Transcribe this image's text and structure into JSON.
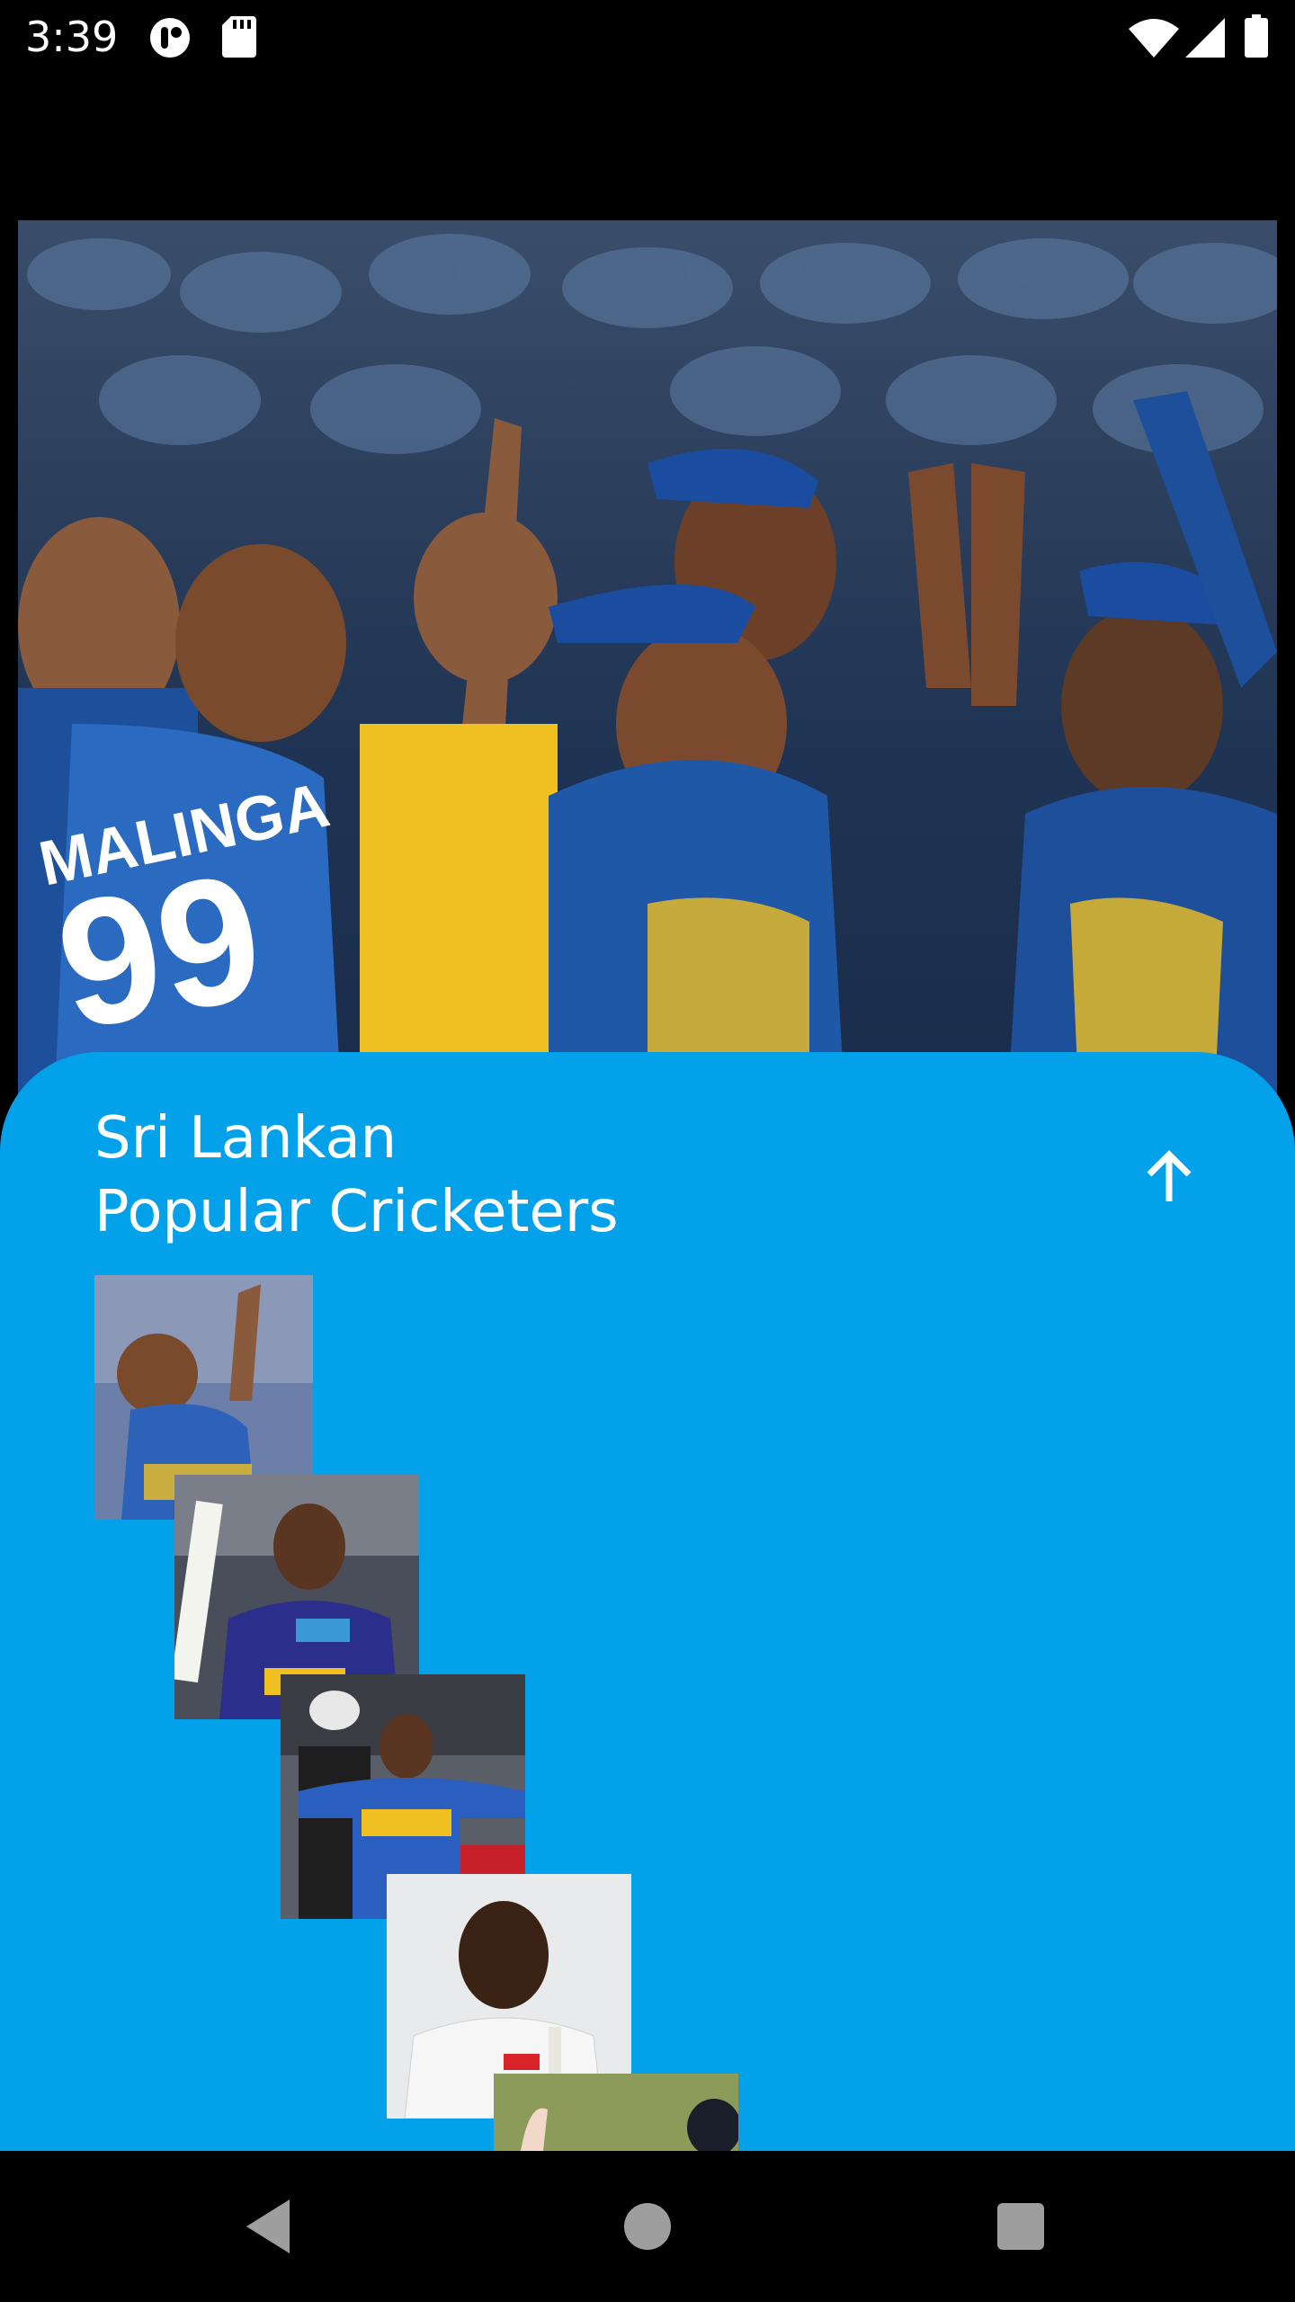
{
  "status_bar": {
    "time": "3:39",
    "icons": [
      "hotspot-icon",
      "sd-card-icon",
      "wifi-icon",
      "cell-signal-icon",
      "battery-icon"
    ]
  },
  "hero": {
    "jersey_name": "MALINGA",
    "jersey_number": "99"
  },
  "sheet": {
    "title_line1": "Sri Lankan",
    "title_line2": "Popular Cricketers",
    "background_color": "#03a1ea",
    "toggle_icon": "arrow-up-icon"
  },
  "cricketers": [
    {
      "id": "cricketer-1"
    },
    {
      "id": "cricketer-2"
    },
    {
      "id": "cricketer-3"
    },
    {
      "id": "cricketer-4"
    },
    {
      "id": "cricketer-5"
    }
  ],
  "nav_bar": {
    "icons": [
      "back-icon",
      "home-icon",
      "recents-icon"
    ]
  }
}
